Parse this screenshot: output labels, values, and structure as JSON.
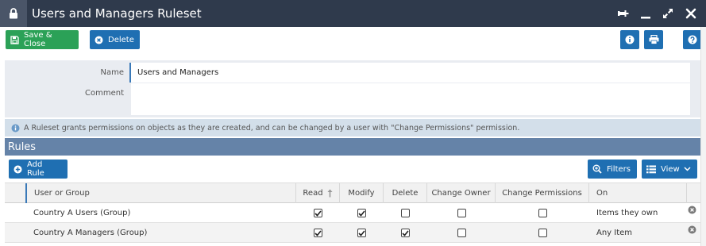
{
  "window": {
    "title": "Users and Managers Ruleset",
    "icons": [
      "lock-icon",
      "pin-icon",
      "minimize-icon",
      "maximize-icon",
      "close-icon"
    ]
  },
  "toolbar": {
    "save_close_label": "Save & Close",
    "delete_label": "Delete",
    "right_icons": [
      "info-icon",
      "print-icon",
      "help-icon"
    ]
  },
  "form": {
    "name_label": "Name",
    "name_value": "Users and Managers",
    "comment_label": "Comment",
    "comment_value": ""
  },
  "info": {
    "text": "A Ruleset grants permissions on objects as they are created, and can be changed by a user with \"Change Permissions\" permission."
  },
  "rules": {
    "section_title": "Rules",
    "add_rule_label": "Add Rule",
    "filters_label": "Filters",
    "view_label": "View",
    "columns": [
      "User or Group",
      "Read",
      "Modify",
      "Delete",
      "Change Owner",
      "Change Permissions",
      "On"
    ],
    "rows": [
      {
        "user": "Country A Users (Group)",
        "read": true,
        "modify": true,
        "delete": false,
        "change_owner": false,
        "change_permissions": false,
        "on": "Items they own"
      },
      {
        "user": "Country A Managers (Group)",
        "read": true,
        "modify": true,
        "delete": true,
        "change_owner": false,
        "change_permissions": false,
        "on": "Any Item"
      }
    ]
  },
  "colors": {
    "titlebar": "#2f3a4c",
    "save_green": "#2ba157",
    "action_blue": "#1f6fb2",
    "section_header": "#6583a8",
    "info_bg": "#d3dfea",
    "form_bg": "#e9ecf1"
  }
}
